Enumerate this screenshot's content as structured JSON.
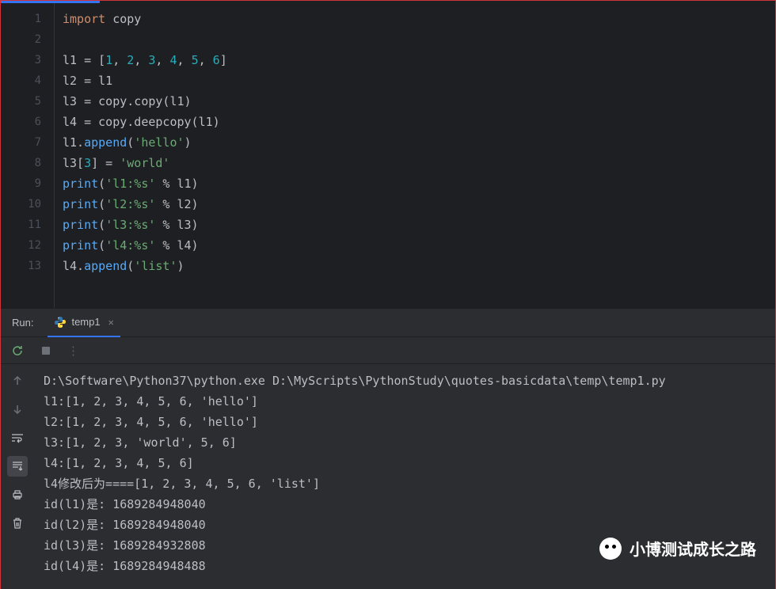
{
  "editor": {
    "lines": [
      {
        "n": "1",
        "tokens": [
          {
            "t": "import",
            "c": "kw"
          },
          {
            "t": " ",
            "c": "op"
          },
          {
            "t": "copy",
            "c": "id"
          }
        ]
      },
      {
        "n": "2",
        "tokens": []
      },
      {
        "n": "3",
        "tokens": [
          {
            "t": "l1 = [",
            "c": "id"
          },
          {
            "t": "1",
            "c": "num"
          },
          {
            "t": ", ",
            "c": "op"
          },
          {
            "t": "2",
            "c": "num"
          },
          {
            "t": ", ",
            "c": "op"
          },
          {
            "t": "3",
            "c": "num"
          },
          {
            "t": ", ",
            "c": "op"
          },
          {
            "t": "4",
            "c": "num"
          },
          {
            "t": ", ",
            "c": "op"
          },
          {
            "t": "5",
            "c": "num"
          },
          {
            "t": ", ",
            "c": "op"
          },
          {
            "t": "6",
            "c": "num"
          },
          {
            "t": "]",
            "c": "op"
          }
        ]
      },
      {
        "n": "4",
        "tokens": [
          {
            "t": "l2 = l1",
            "c": "id"
          }
        ]
      },
      {
        "n": "5",
        "tokens": [
          {
            "t": "l3 = copy.copy(l1)",
            "c": "id"
          }
        ]
      },
      {
        "n": "6",
        "tokens": [
          {
            "t": "l4 = copy.deepcopy(l1)",
            "c": "id"
          }
        ]
      },
      {
        "n": "7",
        "tokens": [
          {
            "t": "l1.",
            "c": "id"
          },
          {
            "t": "append",
            "c": "fn"
          },
          {
            "t": "(",
            "c": "op"
          },
          {
            "t": "'hello'",
            "c": "str"
          },
          {
            "t": ")",
            "c": "op"
          }
        ]
      },
      {
        "n": "8",
        "tokens": [
          {
            "t": "l3[",
            "c": "id"
          },
          {
            "t": "3",
            "c": "num"
          },
          {
            "t": "] = ",
            "c": "op"
          },
          {
            "t": "'world'",
            "c": "str"
          }
        ]
      },
      {
        "n": "9",
        "tokens": [
          {
            "t": "print",
            "c": "fn"
          },
          {
            "t": "(",
            "c": "op"
          },
          {
            "t": "'l1:%s'",
            "c": "str"
          },
          {
            "t": " % l1)",
            "c": "op"
          }
        ]
      },
      {
        "n": "10",
        "tokens": [
          {
            "t": "print",
            "c": "fn"
          },
          {
            "t": "(",
            "c": "op"
          },
          {
            "t": "'l2:%s'",
            "c": "str"
          },
          {
            "t": " % l2)",
            "c": "op"
          }
        ]
      },
      {
        "n": "11",
        "tokens": [
          {
            "t": "print",
            "c": "fn"
          },
          {
            "t": "(",
            "c": "op"
          },
          {
            "t": "'l3:%s'",
            "c": "str"
          },
          {
            "t": " % l3)",
            "c": "op"
          }
        ]
      },
      {
        "n": "12",
        "tokens": [
          {
            "t": "print",
            "c": "fn"
          },
          {
            "t": "(",
            "c": "op"
          },
          {
            "t": "'l4:%s'",
            "c": "str"
          },
          {
            "t": " % l4)",
            "c": "op"
          }
        ]
      },
      {
        "n": "13",
        "tokens": [
          {
            "t": "l4.",
            "c": "id"
          },
          {
            "t": "append",
            "c": "fn"
          },
          {
            "t": "(",
            "c": "op"
          },
          {
            "t": "'list'",
            "c": "str"
          },
          {
            "t": ")",
            "c": "op"
          }
        ]
      }
    ]
  },
  "run": {
    "label": "Run:",
    "file": "temp1",
    "output": [
      "D:\\Software\\Python37\\python.exe D:\\MyScripts\\PythonStudy\\quotes-basicdata\\temp\\temp1.py",
      "l1:[1, 2, 3, 4, 5, 6, 'hello']",
      "l2:[1, 2, 3, 4, 5, 6, 'hello']",
      "l3:[1, 2, 3, 'world', 5, 6]",
      "l4:[1, 2, 3, 4, 5, 6]",
      "l4修改后为====[1, 2, 3, 4, 5, 6, 'list']",
      "id(l1)是: 1689284948040",
      "id(l2)是: 1689284948040",
      "id(l3)是: 1689284932808",
      "id(l4)是: 1689284948488"
    ]
  },
  "watermark": "小博测试成长之路"
}
